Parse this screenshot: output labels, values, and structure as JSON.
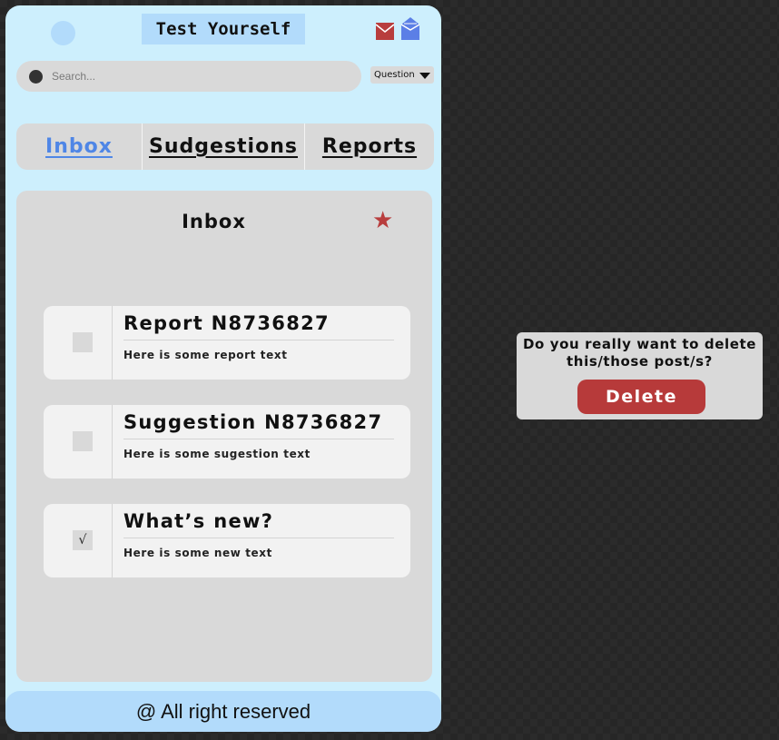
{
  "app": {
    "title": "Test Yourself"
  },
  "header_icons": {
    "avatar": "avatar-circle",
    "mail": "mail-closed-icon",
    "mail_open": "mail-open-icon",
    "accent_red": "#b83d3d",
    "accent_blue": "#5b7fe6"
  },
  "search": {
    "placeholder": "Search...",
    "value": ""
  },
  "filter": {
    "selected": "Question"
  },
  "tabs": [
    {
      "label": "Inbox",
      "active": true
    },
    {
      "label": "Sudgestions",
      "active": false
    },
    {
      "label": "Reports",
      "active": false
    }
  ],
  "panel": {
    "title": "Inbox",
    "star_icon": "star-icon"
  },
  "messages": [
    {
      "title": "Report N8736827",
      "text": "Here is some report text",
      "checked": false,
      "check_mark": ""
    },
    {
      "title": "Suggestion N8736827",
      "text": "Here is some sugestion text",
      "checked": false,
      "check_mark": ""
    },
    {
      "title": "What’s new?",
      "text": "Here is some new text",
      "checked": true,
      "check_mark": "√"
    }
  ],
  "footer": {
    "text": "@ All right reserved"
  },
  "dialog": {
    "line1": "Do you really want to delete",
    "line2": "this/those post/s?",
    "delete_label": "Delete"
  },
  "colors": {
    "phone_bg": "#cdeffd",
    "header_accent": "#b2dbfb",
    "panel_bg": "#d9d9d9",
    "active_tab": "#4f86e6",
    "delete_button": "#b73a3a"
  }
}
